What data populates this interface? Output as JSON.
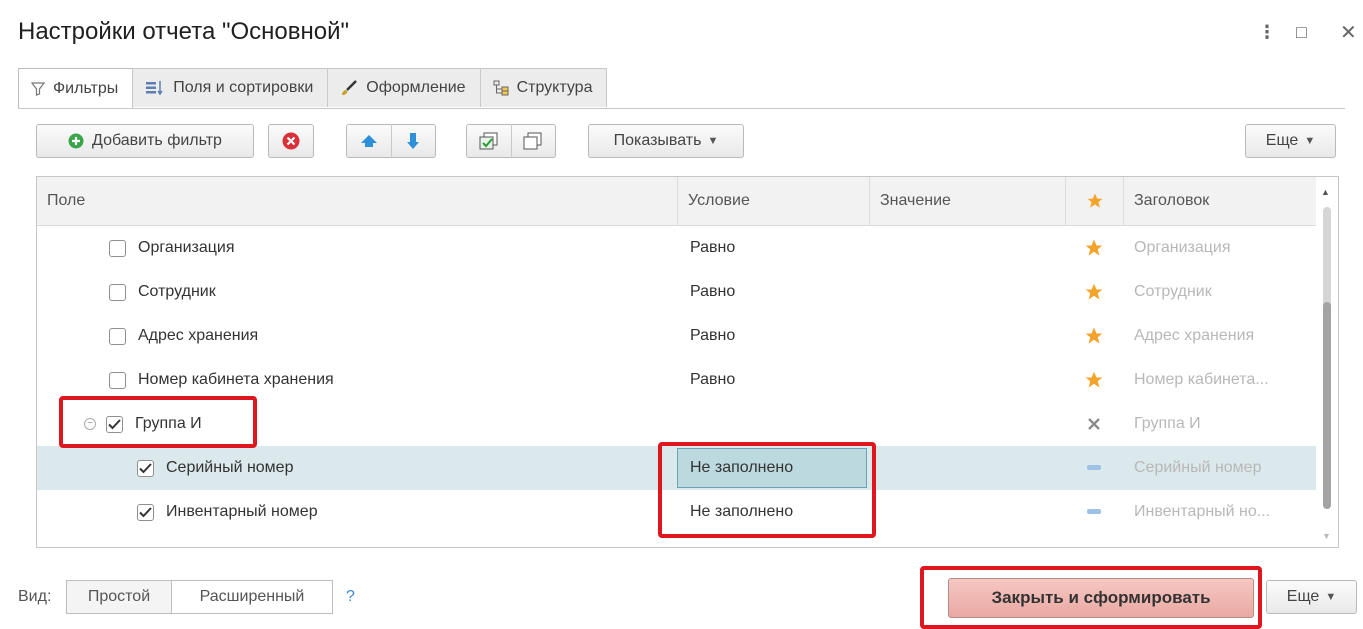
{
  "window": {
    "title": "Настройки отчета \"Основной\"",
    "menu_glyph": "⋮",
    "maximize_glyph": "□",
    "close_glyph": "✕"
  },
  "tabs": [
    {
      "label": "Фильтры",
      "icon": "filter-icon",
      "active": true
    },
    {
      "label": "Поля и сортировки",
      "icon": "fields-sort-icon",
      "active": false
    },
    {
      "label": "Оформление",
      "icon": "brush-icon",
      "active": false
    },
    {
      "label": "Структура",
      "icon": "structure-icon",
      "active": false
    }
  ],
  "toolbar": {
    "add_filter": "Добавить фильтр",
    "show": "Показывать",
    "more": "Еще"
  },
  "grid": {
    "columns": [
      "Поле",
      "Условие",
      "Значение",
      "Заголовок"
    ],
    "rows": [
      {
        "field": "Организация",
        "condition": "Равно",
        "value": "",
        "title": "Организация",
        "mark": "star",
        "checked": false,
        "level": 1
      },
      {
        "field": "Сотрудник",
        "condition": "Равно",
        "value": "",
        "title": "Сотрудник",
        "mark": "star",
        "checked": false,
        "level": 1
      },
      {
        "field": "Адрес хранения",
        "condition": "Равно",
        "value": "",
        "title": "Адрес хранения",
        "mark": "star",
        "checked": false,
        "level": 1
      },
      {
        "field": "Номер кабинета хранения",
        "condition": "Равно",
        "value": "",
        "title": "Номер кабинета...",
        "mark": "star",
        "checked": false,
        "level": 1
      },
      {
        "field": "Группа И",
        "condition": "",
        "value": "",
        "title": "Группа И",
        "mark": "cross",
        "checked": true,
        "level": 1,
        "group": true
      },
      {
        "field": "Серийный номер",
        "condition": "Не заполнено",
        "value": "",
        "title": "Серийный номер",
        "mark": "dash",
        "checked": true,
        "level": 2,
        "selected": true
      },
      {
        "field": "Инвентарный номер",
        "condition": "Не заполнено",
        "value": "",
        "title": "Инвентарный но...",
        "mark": "dash",
        "checked": true,
        "level": 2
      }
    ]
  },
  "footer": {
    "view_label": "Вид:",
    "simple": "Простой",
    "extended": "Расширенный",
    "help": "?",
    "close_and_build": "Закрыть и сформировать",
    "more": "Еще"
  },
  "colors": {
    "star": "#f3a329",
    "cross": "#8c8c8c",
    "dash": "#9ec2e6",
    "highlight": "#e0161e",
    "primary_button": "#f0b8b2"
  }
}
